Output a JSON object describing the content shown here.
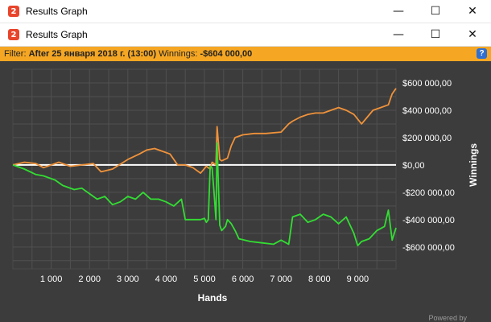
{
  "outer_window": {
    "title": "Results Graph",
    "controls": [
      "—",
      "☐",
      "✕"
    ]
  },
  "inner_window": {
    "title": "Results Graph",
    "controls": [
      "—",
      "☐",
      "✕"
    ]
  },
  "app_icon_glyph": "2",
  "filter": {
    "label": "Filter:",
    "value": "After 25 января 2018 г. (13:00)",
    "winnings_label": "Winnings:",
    "winnings_value": "-$604 000,00",
    "help_glyph": "?"
  },
  "footer": {
    "text": "Powered by"
  },
  "colors": {
    "bar": "#f5a623",
    "orange": "#f0923a",
    "green": "#33dd33",
    "zero": "#ffffff",
    "plot_bg": "#3c3c3c",
    "grid": "#505050"
  },
  "chart_data": {
    "type": "line",
    "xlabel": "Hands",
    "ylabel": "Winnings",
    "xlim": [
      0,
      10000
    ],
    "ylim": [
      -760000,
      700000
    ],
    "x_ticks": [
      1000,
      2000,
      3000,
      4000,
      5000,
      6000,
      7000,
      8000,
      9000
    ],
    "x_tick_labels": [
      "1 000",
      "2 000",
      "3 000",
      "4 000",
      "5 000",
      "6 000",
      "7 000",
      "8 000",
      "9 000"
    ],
    "y_ticks": [
      600000,
      400000,
      200000,
      0,
      -200000,
      -400000,
      -600000
    ],
    "y_tick_labels": [
      "$600 000,00",
      "$400 000,00",
      "$200 000,00",
      "$0,00",
      "-$200 000,00",
      "-$400 000,00",
      "-$600 000,00"
    ],
    "grid": true,
    "series": [
      {
        "color": "#f0923a",
        "x": [
          0,
          300,
          600,
          800,
          1200,
          1500,
          1800,
          2100,
          2300,
          2600,
          3000,
          3300,
          3500,
          3700,
          3900,
          4100,
          4300,
          4500,
          4700,
          4900,
          5050,
          5150,
          5200,
          5300,
          5330,
          5400,
          5450,
          5600,
          5700,
          5800,
          6000,
          6300,
          6600,
          7000,
          7200,
          7300,
          7500,
          7700,
          7900,
          8100,
          8300,
          8500,
          8700,
          8900,
          9100,
          9250,
          9400,
          9600,
          9800,
          9900,
          10000
        ],
        "y": [
          0,
          20000,
          10000,
          -20000,
          20000,
          -10000,
          0,
          10000,
          -50000,
          -30000,
          40000,
          80000,
          110000,
          120000,
          100000,
          80000,
          0,
          0,
          -20000,
          -60000,
          -10000,
          -30000,
          20000,
          0,
          280000,
          40000,
          30000,
          50000,
          140000,
          200000,
          220000,
          230000,
          230000,
          240000,
          300000,
          320000,
          350000,
          370000,
          380000,
          380000,
          400000,
          420000,
          400000,
          370000,
          300000,
          350000,
          400000,
          420000,
          440000,
          520000,
          560000
        ]
      },
      {
        "color": "#33dd33",
        "x": [
          0,
          300,
          600,
          800,
          1100,
          1300,
          1600,
          1800,
          2000,
          2200,
          2400,
          2600,
          2800,
          3000,
          3200,
          3400,
          3600,
          3800,
          4000,
          4200,
          4400,
          4500,
          4700,
          4900,
          5000,
          5050,
          5100,
          5150,
          5200,
          5250,
          5300,
          5330,
          5360,
          5400,
          5450,
          5550,
          5600,
          5700,
          5800,
          5900,
          6200,
          6500,
          6800,
          7000,
          7200,
          7300,
          7500,
          7700,
          7900,
          8100,
          8300,
          8500,
          8700,
          8900,
          9000,
          9100,
          9300,
          9500,
          9700,
          9800,
          9900,
          10000
        ],
        "y": [
          0,
          -30000,
          -70000,
          -80000,
          -110000,
          -150000,
          -180000,
          -170000,
          -210000,
          -250000,
          -230000,
          -290000,
          -270000,
          -230000,
          -250000,
          -200000,
          -250000,
          -250000,
          -270000,
          -300000,
          -250000,
          -400000,
          -400000,
          -400000,
          -390000,
          -420000,
          -400000,
          -10000,
          -20000,
          -200000,
          -400000,
          160000,
          -100000,
          -440000,
          -480000,
          -450000,
          -400000,
          -430000,
          -480000,
          -540000,
          -560000,
          -570000,
          -580000,
          -550000,
          -580000,
          -380000,
          -360000,
          -420000,
          -400000,
          -360000,
          -380000,
          -430000,
          -380000,
          -500000,
          -590000,
          -560000,
          -540000,
          -480000,
          -450000,
          -330000,
          -550000,
          -460000
        ]
      }
    ]
  }
}
